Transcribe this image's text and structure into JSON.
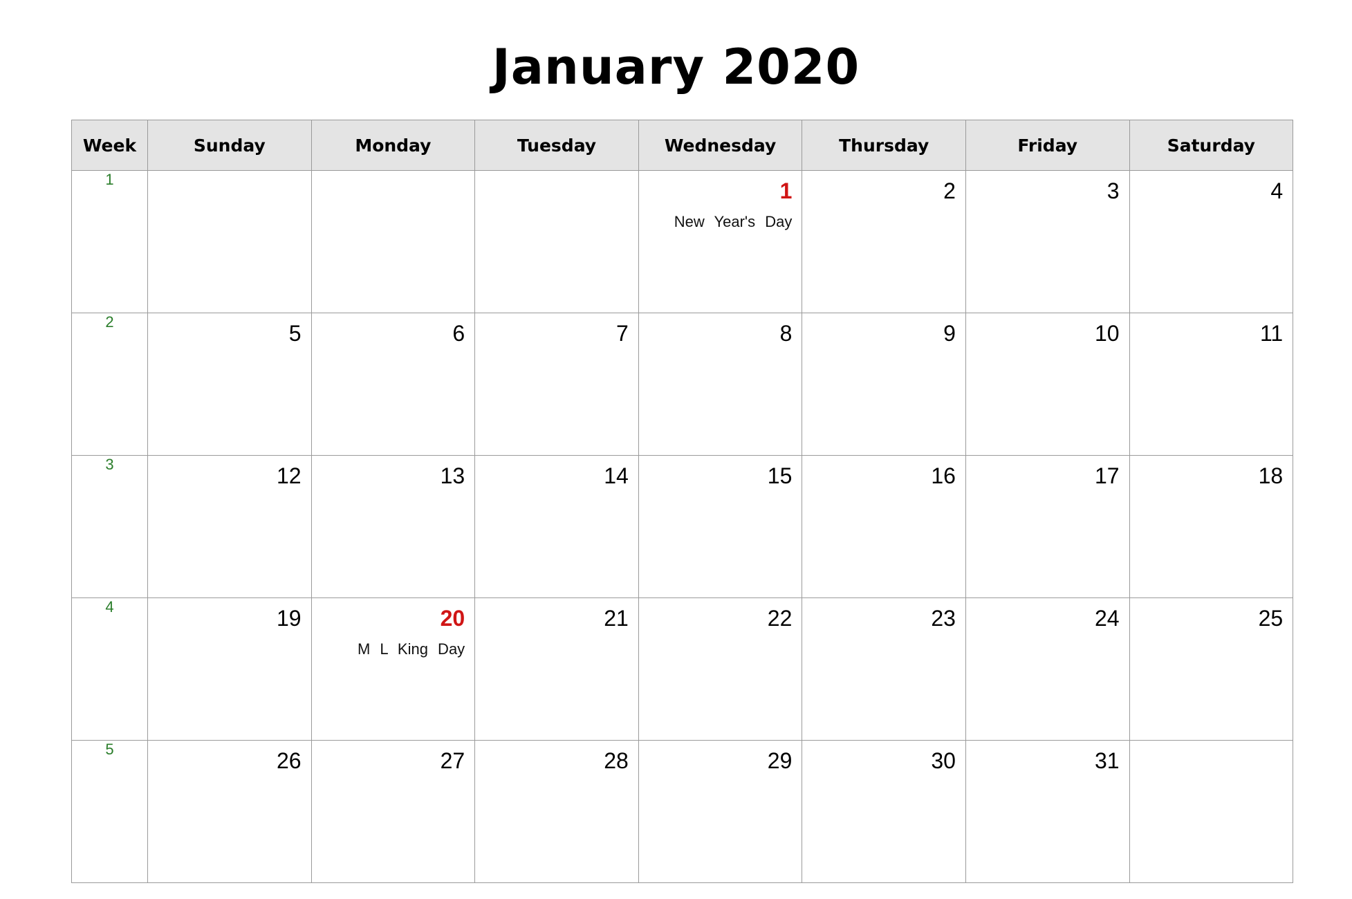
{
  "title": "January 2020",
  "colors": {
    "holiday": "#d01515",
    "week_number": "#2a7d2a",
    "header_bg": "#e4e4e4",
    "grid": "#9a9a9a"
  },
  "header": [
    "Week",
    "Sunday",
    "Monday",
    "Tuesday",
    "Wednesday",
    "Thursday",
    "Friday",
    "Saturday"
  ],
  "weeks": [
    {
      "week": "1",
      "days": [
        {
          "day": "",
          "holiday": ""
        },
        {
          "day": "",
          "holiday": ""
        },
        {
          "day": "",
          "holiday": ""
        },
        {
          "day": "1",
          "holiday": "New Year's Day"
        },
        {
          "day": "2",
          "holiday": ""
        },
        {
          "day": "3",
          "holiday": ""
        },
        {
          "day": "4",
          "holiday": ""
        }
      ]
    },
    {
      "week": "2",
      "days": [
        {
          "day": "5",
          "holiday": ""
        },
        {
          "day": "6",
          "holiday": ""
        },
        {
          "day": "7",
          "holiday": ""
        },
        {
          "day": "8",
          "holiday": ""
        },
        {
          "day": "9",
          "holiday": ""
        },
        {
          "day": "10",
          "holiday": ""
        },
        {
          "day": "11",
          "holiday": ""
        }
      ]
    },
    {
      "week": "3",
      "days": [
        {
          "day": "12",
          "holiday": ""
        },
        {
          "day": "13",
          "holiday": ""
        },
        {
          "day": "14",
          "holiday": ""
        },
        {
          "day": "15",
          "holiday": ""
        },
        {
          "day": "16",
          "holiday": ""
        },
        {
          "day": "17",
          "holiday": ""
        },
        {
          "day": "18",
          "holiday": ""
        }
      ]
    },
    {
      "week": "4",
      "days": [
        {
          "day": "19",
          "holiday": ""
        },
        {
          "day": "20",
          "holiday": "M L King Day"
        },
        {
          "day": "21",
          "holiday": ""
        },
        {
          "day": "22",
          "holiday": ""
        },
        {
          "day": "23",
          "holiday": ""
        },
        {
          "day": "24",
          "holiday": ""
        },
        {
          "day": "25",
          "holiday": ""
        }
      ]
    },
    {
      "week": "5",
      "days": [
        {
          "day": "26",
          "holiday": ""
        },
        {
          "day": "27",
          "holiday": ""
        },
        {
          "day": "28",
          "holiday": ""
        },
        {
          "day": "29",
          "holiday": ""
        },
        {
          "day": "30",
          "holiday": ""
        },
        {
          "day": "31",
          "holiday": ""
        },
        {
          "day": "",
          "holiday": ""
        }
      ]
    }
  ]
}
